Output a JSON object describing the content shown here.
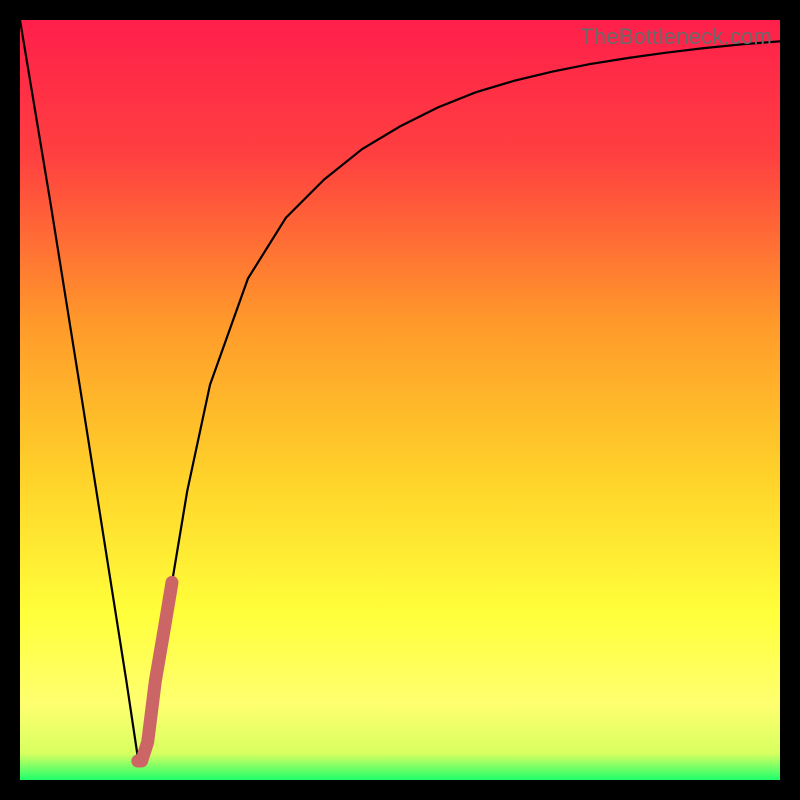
{
  "brand": {
    "watermark": "TheBottleneck.com"
  },
  "colors": {
    "frame": "#000000",
    "grad_top": "#ff1f4b",
    "grad_mid": "#ffcf1f",
    "grad_yellow": "#ffff40",
    "grad_green": "#1eff6b",
    "curve": "#000000",
    "mark": "#cc6666"
  },
  "chart_data": {
    "type": "line",
    "title": "",
    "xlabel": "",
    "ylabel": "",
    "xlim": [
      0,
      100
    ],
    "ylim": [
      0,
      100
    ],
    "series": [
      {
        "name": "bottleneck-curve",
        "x": [
          0,
          4,
          8,
          11,
          14,
          15.5,
          16.5,
          18,
          20,
          22,
          25,
          30,
          35,
          40,
          45,
          50,
          55,
          60,
          65,
          70,
          75,
          80,
          85,
          90,
          95,
          100
        ],
        "values": [
          100,
          76,
          51,
          32,
          13,
          3,
          3,
          13,
          26,
          38,
          52,
          66,
          74,
          79,
          83,
          86,
          88.5,
          90.5,
          92,
          93.2,
          94.2,
          95,
          95.7,
          96.3,
          96.8,
          97.2
        ]
      },
      {
        "name": "highlight-segment",
        "x": [
          15.5,
          16.0,
          16.8,
          17.8,
          19.0,
          20.0
        ],
        "values": [
          2.5,
          2.5,
          5,
          13,
          20,
          26
        ]
      }
    ],
    "gradient_stops": [
      {
        "offset": 0.0,
        "color": "#ff1f4b"
      },
      {
        "offset": 0.18,
        "color": "#ff4040"
      },
      {
        "offset": 0.4,
        "color": "#ff9a2a"
      },
      {
        "offset": 0.6,
        "color": "#ffd22a"
      },
      {
        "offset": 0.78,
        "color": "#ffff3a"
      },
      {
        "offset": 0.9,
        "color": "#ffff70"
      },
      {
        "offset": 0.965,
        "color": "#d8ff60"
      },
      {
        "offset": 1.0,
        "color": "#1eff6b"
      }
    ]
  }
}
